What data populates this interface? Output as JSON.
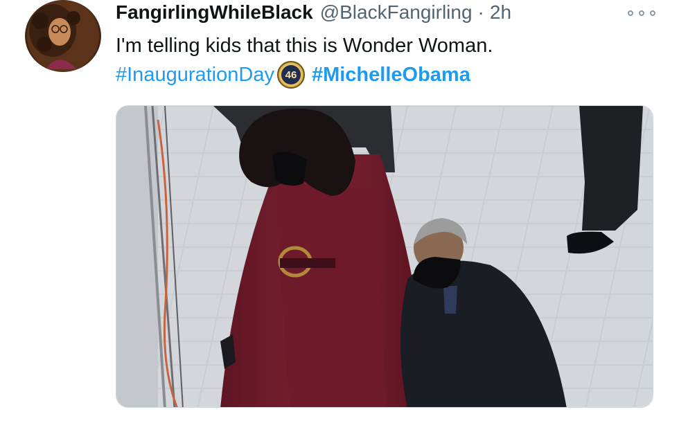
{
  "tweet": {
    "display_name": "FangirlingWhileBlack",
    "handle": "@BlackFangirling",
    "separator": "·",
    "time": "2h",
    "text": "I'm telling kids that this is Wonder Woman.",
    "hashtags": [
      {
        "label": "#InaugurationDay",
        "bold": false
      },
      {
        "label": "#MichelleObama",
        "bold": true
      }
    ],
    "hashflag_text": "46",
    "icons": {
      "more": "more-options-icon",
      "hashflag": "inauguration-hashflag-icon"
    }
  },
  "colors": {
    "name": "#0f1419",
    "secondary": "#536471",
    "link": "#1d9bf0",
    "burgundy": "#7a1e2e",
    "coat_dark": "#1b1d24"
  }
}
